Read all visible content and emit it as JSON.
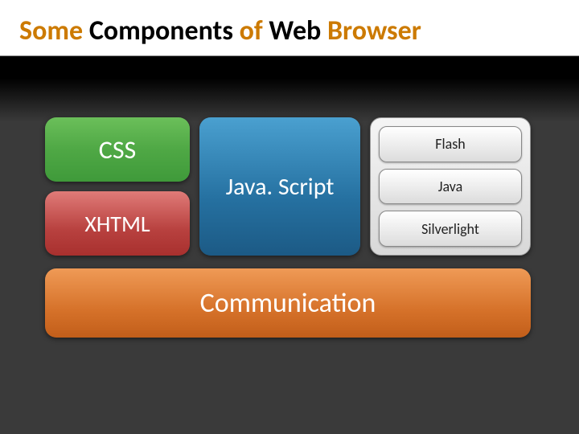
{
  "title": {
    "w1": "Some ",
    "w2": "Components ",
    "w3": "of ",
    "w4": "Web ",
    "w5": "Browser"
  },
  "blocks": {
    "css": "CSS",
    "xhtml": "XHTML",
    "javascript": "Java. Script",
    "communication": "Communication"
  },
  "plugins": {
    "flash": "Flash",
    "java": "Java",
    "silverlight": "Silverlight"
  }
}
